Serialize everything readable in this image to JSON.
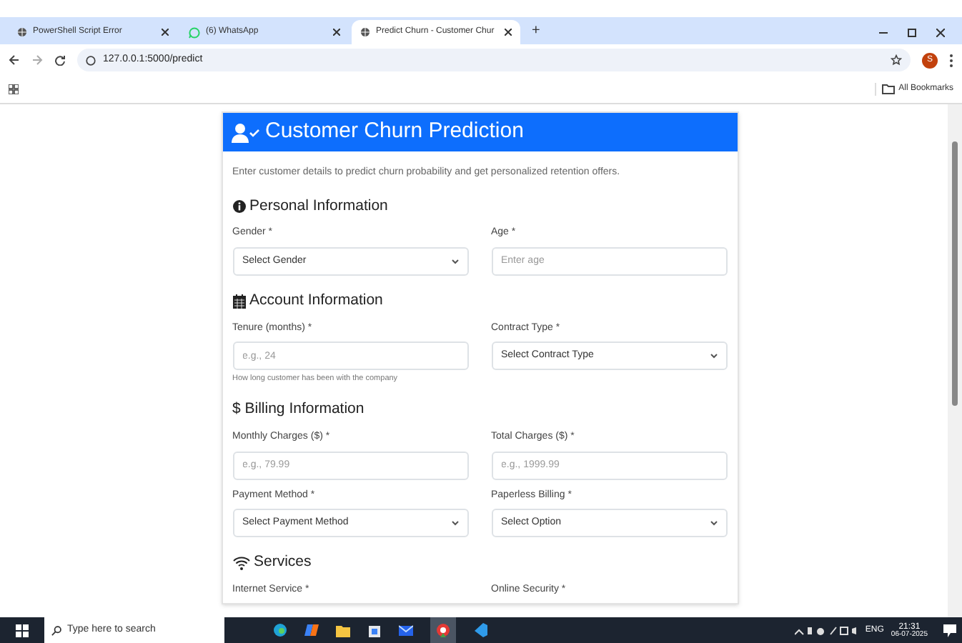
{
  "browser": {
    "tabs": [
      {
        "title": "PowerShell Script Error",
        "selected": false,
        "kind": "web"
      },
      {
        "title": "(6) WhatsApp",
        "selected": false,
        "kind": "chat"
      },
      {
        "title": "Predict Churn - Customer Chur",
        "selected": true,
        "kind": "web"
      }
    ],
    "new_tab": "+",
    "url": "127.0.0.1:5000/predict",
    "profile": "S",
    "bookmarks": "All Bookmarks"
  },
  "card": {
    "title": "Customer Churn Prediction",
    "description": "Enter customer details to predict churn probability and get personalized retention offers.",
    "sections": [
      {
        "kind": "info",
        "title": "Personal Information",
        "fields": [
          {
            "kind": "select",
            "label": "Gender *",
            "placeholder": "Select Gender"
          },
          {
            "kind": "input",
            "label": "Age *",
            "placeholder": "Enter age"
          }
        ]
      },
      {
        "kind": "account",
        "title": "Account Information",
        "fields": [
          {
            "kind": "input",
            "label": "Tenure (months) *",
            "placeholder": "e.g., 24",
            "help": "How long customer has been with the company"
          },
          {
            "kind": "select",
            "label": "Contract Type *",
            "placeholder": "Select Contract Type"
          }
        ]
      },
      {
        "kind": "billing",
        "title": "$ Billing Information",
        "fields": [
          {
            "kind": "input",
            "label": "Monthly Charges ($) *",
            "placeholder": "e.g., 79.99"
          },
          {
            "kind": "input",
            "label": "Total Charges ($) *",
            "placeholder": "e.g., 1999.99"
          },
          {
            "kind": "select",
            "label": "Payment Method *",
            "placeholder": "Select Payment Method"
          },
          {
            "kind": "select",
            "label": "Paperless Billing *",
            "placeholder": "Select Option"
          }
        ]
      },
      {
        "kind": "services",
        "title": "Services",
        "fields": [
          {
            "kind": "label",
            "label": "Internet Service *"
          },
          {
            "kind": "label",
            "label": "Online Security *"
          }
        ]
      }
    ]
  },
  "taskbar": {
    "search_placeholder": "Type here to search",
    "language": "ENG",
    "time": "21:31",
    "date": "06-07-2025"
  }
}
